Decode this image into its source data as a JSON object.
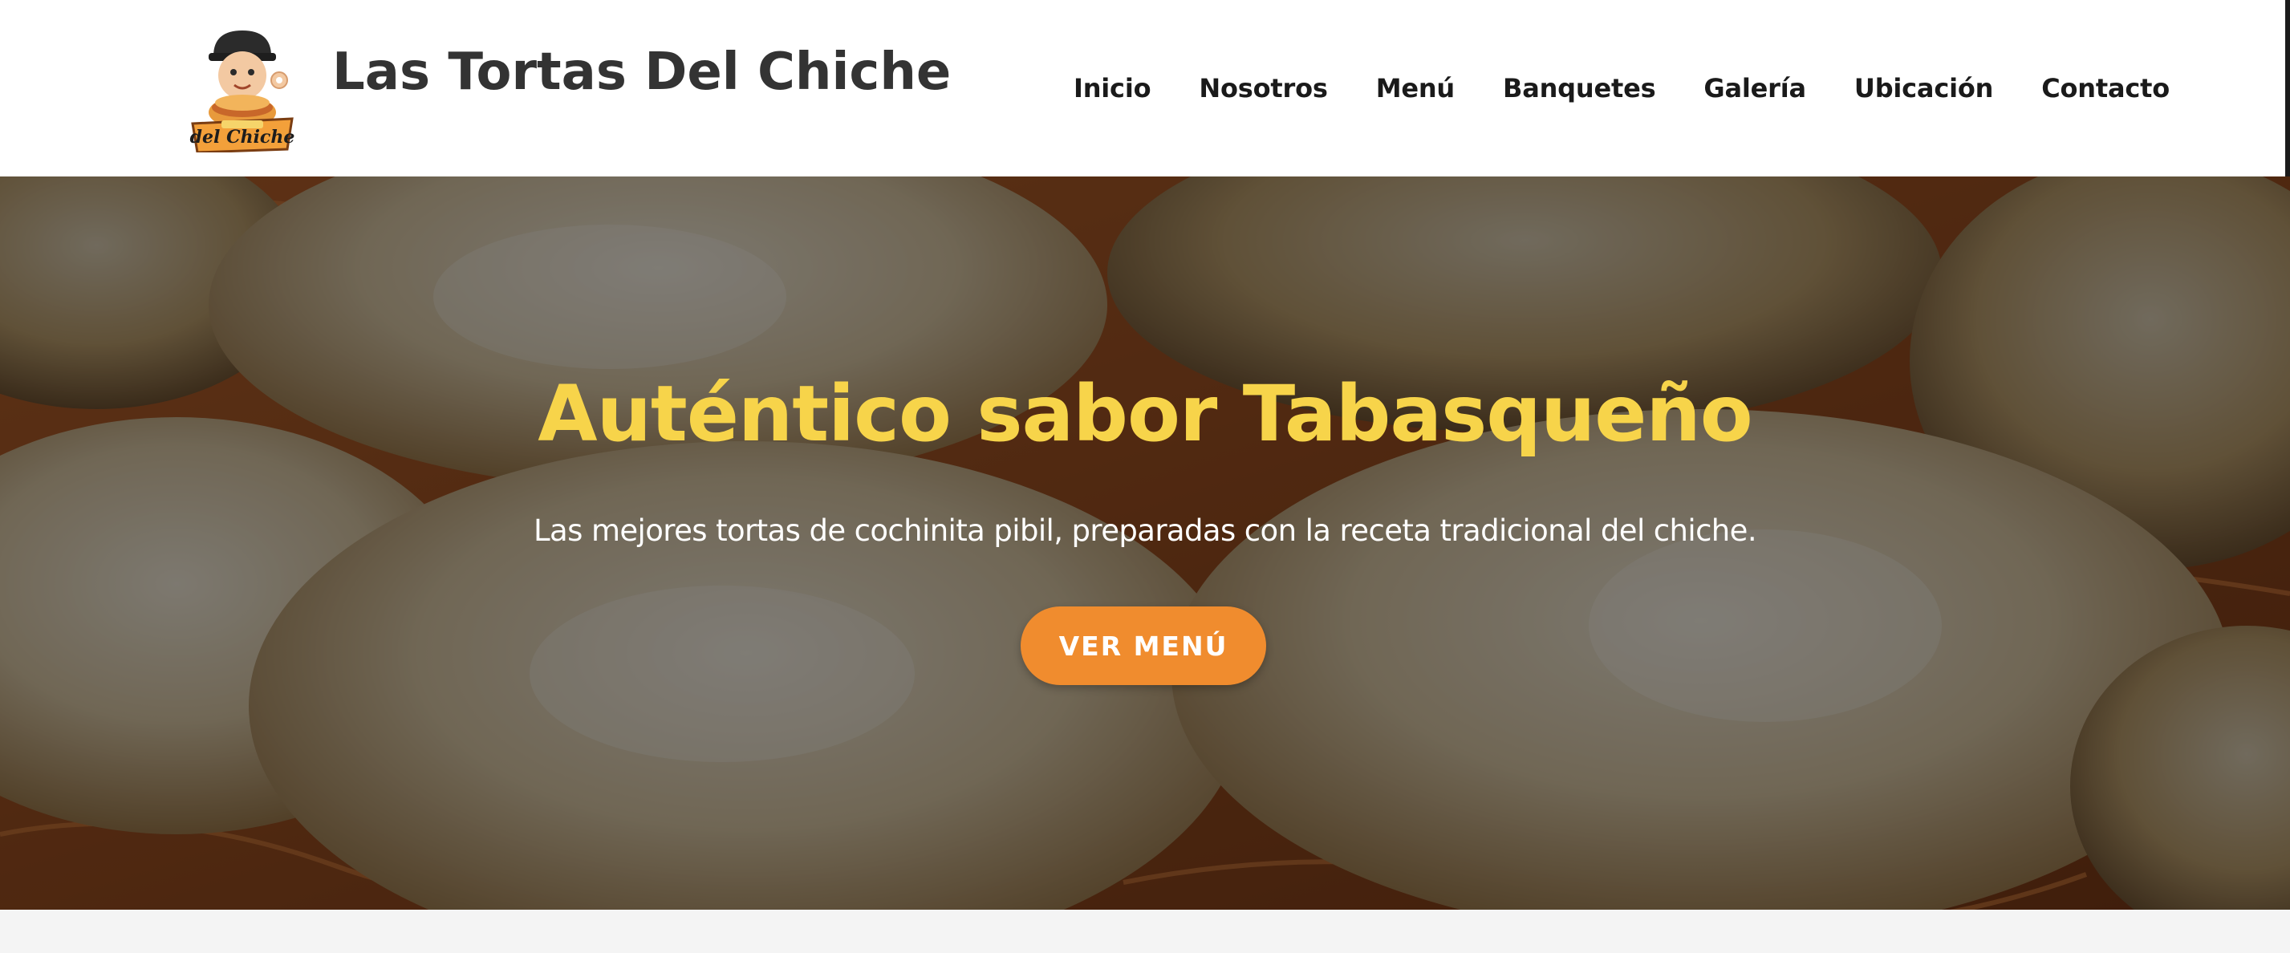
{
  "header": {
    "brand": "Las Tortas Del Chiche",
    "logo_text": "del Chiche"
  },
  "nav": {
    "items": [
      {
        "label": "Inicio"
      },
      {
        "label": "Nosotros"
      },
      {
        "label": "Menú"
      },
      {
        "label": "Banquetes"
      },
      {
        "label": "Galería"
      },
      {
        "label": "Ubicación"
      },
      {
        "label": "Contacto"
      }
    ]
  },
  "hero": {
    "title": "Auténtico sabor Tabasqueño",
    "subtitle": "Las mejores tortas de cochinita pibil, preparadas con la receta tradicional del chiche.",
    "cta_label": "VER MENÚ"
  },
  "colors": {
    "title_yellow": "#f7d44a",
    "cta_orange": "#f08c2e",
    "brand_text": "#333333",
    "nav_text": "#1a1a1a"
  }
}
